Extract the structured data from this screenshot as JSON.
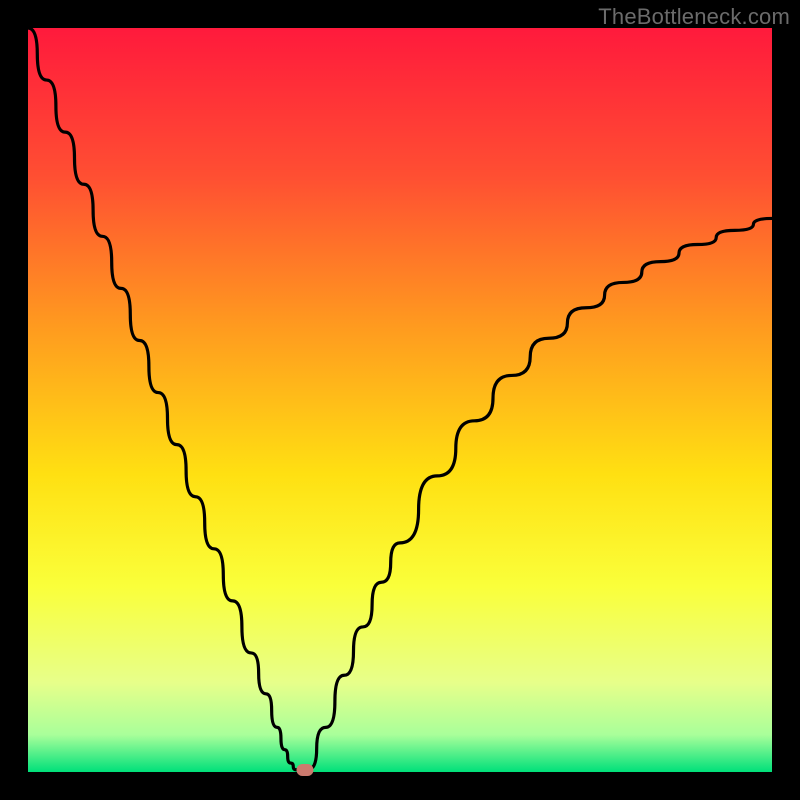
{
  "watermark": "TheBottleneck.com",
  "chart_data": {
    "type": "line",
    "title": "",
    "xlabel": "",
    "ylabel": "",
    "xlim": [
      0,
      100
    ],
    "ylim": [
      0,
      100
    ],
    "grid": false,
    "legend": false,
    "background_gradient": {
      "stops": [
        {
          "pos": 0.0,
          "color": "#ff1a3c"
        },
        {
          "pos": 0.2,
          "color": "#ff4f32"
        },
        {
          "pos": 0.4,
          "color": "#ff9a1f"
        },
        {
          "pos": 0.6,
          "color": "#ffe012"
        },
        {
          "pos": 0.75,
          "color": "#faff3a"
        },
        {
          "pos": 0.88,
          "color": "#e7ff8a"
        },
        {
          "pos": 0.95,
          "color": "#a9ff9a"
        },
        {
          "pos": 1.0,
          "color": "#00e07a"
        }
      ]
    },
    "series": [
      {
        "name": "bottleneck-curve",
        "x": [
          0.0,
          2.5,
          5.0,
          7.5,
          10.0,
          12.5,
          15.0,
          17.5,
          20.0,
          22.5,
          25.0,
          27.5,
          30.0,
          32.0,
          33.5,
          34.5,
          35.3,
          36.0,
          36.8,
          37.6,
          40.0,
          42.5,
          45.0,
          47.5,
          50.0,
          55.0,
          60.0,
          65.0,
          70.0,
          75.0,
          80.0,
          85.0,
          90.0,
          95.0,
          100.0
        ],
        "y": [
          100.0,
          93.0,
          86.0,
          79.0,
          72.0,
          65.0,
          58.0,
          51.0,
          44.0,
          37.0,
          30.0,
          23.0,
          16.0,
          10.5,
          6.0,
          3.0,
          1.2,
          0.3,
          0.3,
          0.3,
          6.0,
          13.0,
          19.5,
          25.5,
          30.8,
          39.8,
          47.2,
          53.3,
          58.3,
          62.4,
          65.8,
          68.6,
          70.9,
          72.8,
          74.4
        ]
      }
    ],
    "marker": {
      "x": 37.2,
      "y": 0.3,
      "color": "#cb7a6e"
    }
  }
}
